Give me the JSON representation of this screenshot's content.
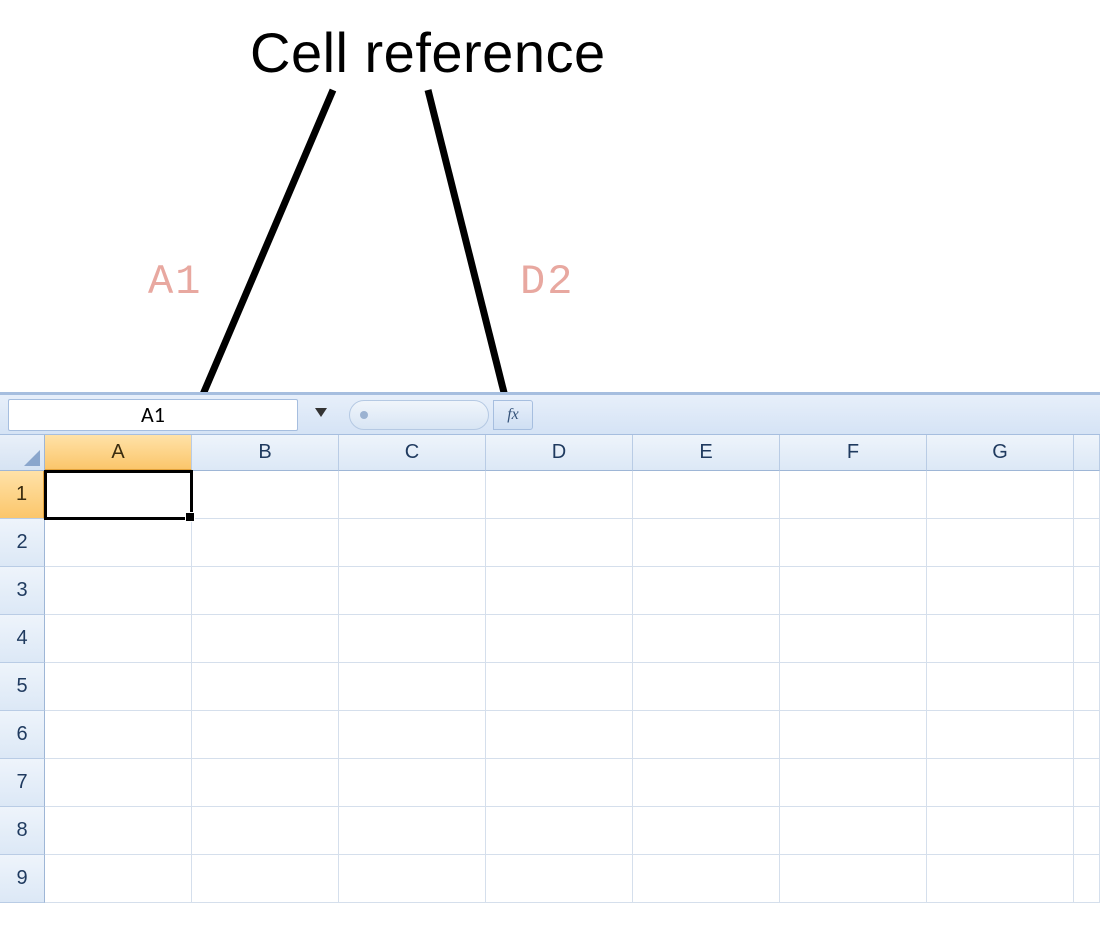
{
  "annotation": {
    "title": "Cell reference",
    "label_left": "A1",
    "label_right": "D2"
  },
  "formula_bar": {
    "name_box_value": "A1",
    "fx_label": "fx"
  },
  "grid": {
    "columns": [
      "A",
      "B",
      "C",
      "D",
      "E",
      "F",
      "G"
    ],
    "rows": [
      "1",
      "2",
      "3",
      "4",
      "5",
      "6",
      "7",
      "8",
      "9"
    ],
    "active_column": "A",
    "active_row": "1",
    "selected_cell": "A1"
  }
}
